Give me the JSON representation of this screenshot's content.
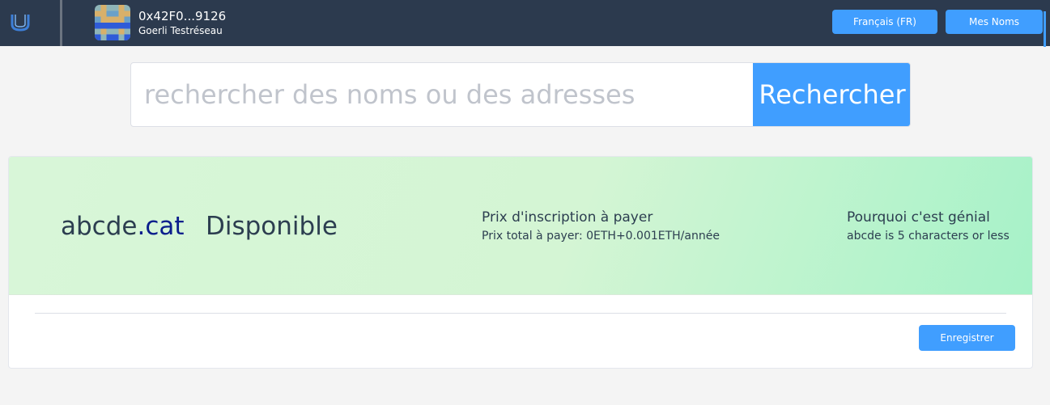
{
  "header": {
    "account_address": "0x42F0...9126",
    "network": "Goerli Testréseau",
    "language_button": "Français (FR)",
    "my_names_button": "Mes Noms"
  },
  "search": {
    "placeholder": "rechercher des noms ou des adresses",
    "value": "",
    "button_label": "Rechercher"
  },
  "result": {
    "name": "abcde",
    "tld": ".cat",
    "status": "Disponible",
    "price_title": "Prix d'inscription à payer",
    "price_detail": "Prix total à payer:  0ETH+0.001ETH/année",
    "why_title": "Pourquoi c'est génial",
    "why_detail": "abcde is 5 characters or less",
    "register_button": "Enregistrer"
  },
  "colors": {
    "topbar": "#2c3a4e",
    "accent": "#409eff",
    "hero_gradient_start": "#d8f6d8",
    "hero_gradient_end": "#a6f2c8"
  },
  "icons": {
    "logo": "app-logo-icon",
    "avatar": "pixel-avatar"
  }
}
